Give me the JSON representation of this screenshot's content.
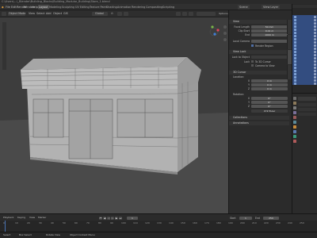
{
  "window": {
    "title": "C:\\Users\\...\\_Blender\\Building_Blocks\\Building_Modular_Building\\Store_1.blend"
  },
  "menu": {
    "items": [
      "File",
      "Edit",
      "Render",
      "Window",
      "Help"
    ],
    "workspaces": [
      "Layout",
      "Modeling",
      "Sculpting",
      "UV Editing",
      "Texture Paint",
      "Shading",
      "Animation",
      "Rendering",
      "Compositing",
      "Scripting"
    ],
    "active_workspace": "Layout",
    "scene_label": "Scene",
    "view_layer_label": "View Layer"
  },
  "viewport_header": {
    "mode": "Object Mode",
    "menus": [
      "View",
      "Select",
      "Add",
      "Object",
      "GIS"
    ],
    "orientation": "Global",
    "pivot": "⊙",
    "options_label": "Options"
  },
  "npanel": {
    "view_section": "View",
    "focal_length_label": "Focal Length",
    "focal_length_value": "50 mm",
    "clip_start_label": "Clip Start",
    "clip_start_value": "0.01 m",
    "clip_end_label": "End",
    "clip_end_value": "1000 m",
    "local_camera_label": "Local Camera",
    "local_camera_value": "",
    "render_region_label": "Render Region",
    "view_lock_section": "View Lock",
    "lock_to_object_label": "Lock to Object",
    "lock_label": "Lock",
    "to_3d_cursor_label": "To 3D Cursor",
    "camera_to_view_label": "Camera to View",
    "cursor_section": "3D Cursor",
    "location_label": "Location:",
    "loc_x_label": "X",
    "loc_x_value": "0 m",
    "loc_y_label": "Y",
    "loc_y_value": "0 m",
    "loc_z_label": "Z",
    "loc_z_value": "0 m",
    "rotation_label": "Rotation:",
    "rot_x_label": "X",
    "rot_x_value": "0°",
    "rot_y_label": "Y",
    "rot_y_value": "0°",
    "rot_z_label": "Z",
    "rot_z_value": "0°",
    "rotation_mode_value": "XYZ Euler",
    "collections_section": "Collections",
    "annotations_section": "Annotations",
    "tabs": [
      "Item",
      "Tool",
      "View",
      "Edit"
    ]
  },
  "timeline": {
    "playback_label": "Playback",
    "keying_label": "Keying",
    "view_label": "View",
    "marker_label": "Marker",
    "current_frame": "1",
    "start_label": "Start",
    "start_value": "1",
    "end_label": "End",
    "end_value": "250",
    "ticks": [
      "0",
      "10",
      "20",
      "30",
      "40",
      "50",
      "60",
      "70",
      "80",
      "90",
      "100",
      "110",
      "120",
      "130",
      "140",
      "150",
      "160",
      "170",
      "180",
      "190",
      "200",
      "210",
      "220",
      "230",
      "240",
      "250"
    ]
  },
  "statusbar": {
    "select_label": "Select",
    "box_select_label": "Box Select",
    "rotate_view_label": "Rotate View",
    "context_menu_label": "Object Context Menu"
  },
  "outliner": {
    "row_count": 22
  },
  "colors": {
    "accent": "#4772b3",
    "selected_row": "#334d80",
    "viewport_bg": "#3d3d3d"
  }
}
